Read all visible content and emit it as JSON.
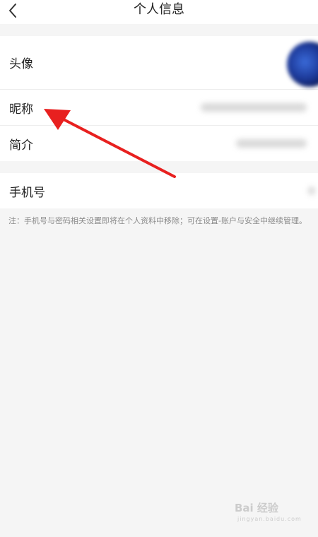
{
  "header": {
    "title": "个人信息"
  },
  "profile_rows": [
    {
      "label": "头像"
    },
    {
      "label": "昵称"
    },
    {
      "label": "简介"
    }
  ],
  "phone_row": {
    "label": "手机号"
  },
  "note": "注：手机号与密码相关设置即将在个人资料中移除；可在设置-账户与安全中继续管理。",
  "annotation": {
    "color": "#e8201f"
  },
  "watermark": {
    "brand": "Bai 经验",
    "sub": "jingyan.baidu.com"
  },
  "icons": {
    "back": "chevron-left-icon"
  }
}
